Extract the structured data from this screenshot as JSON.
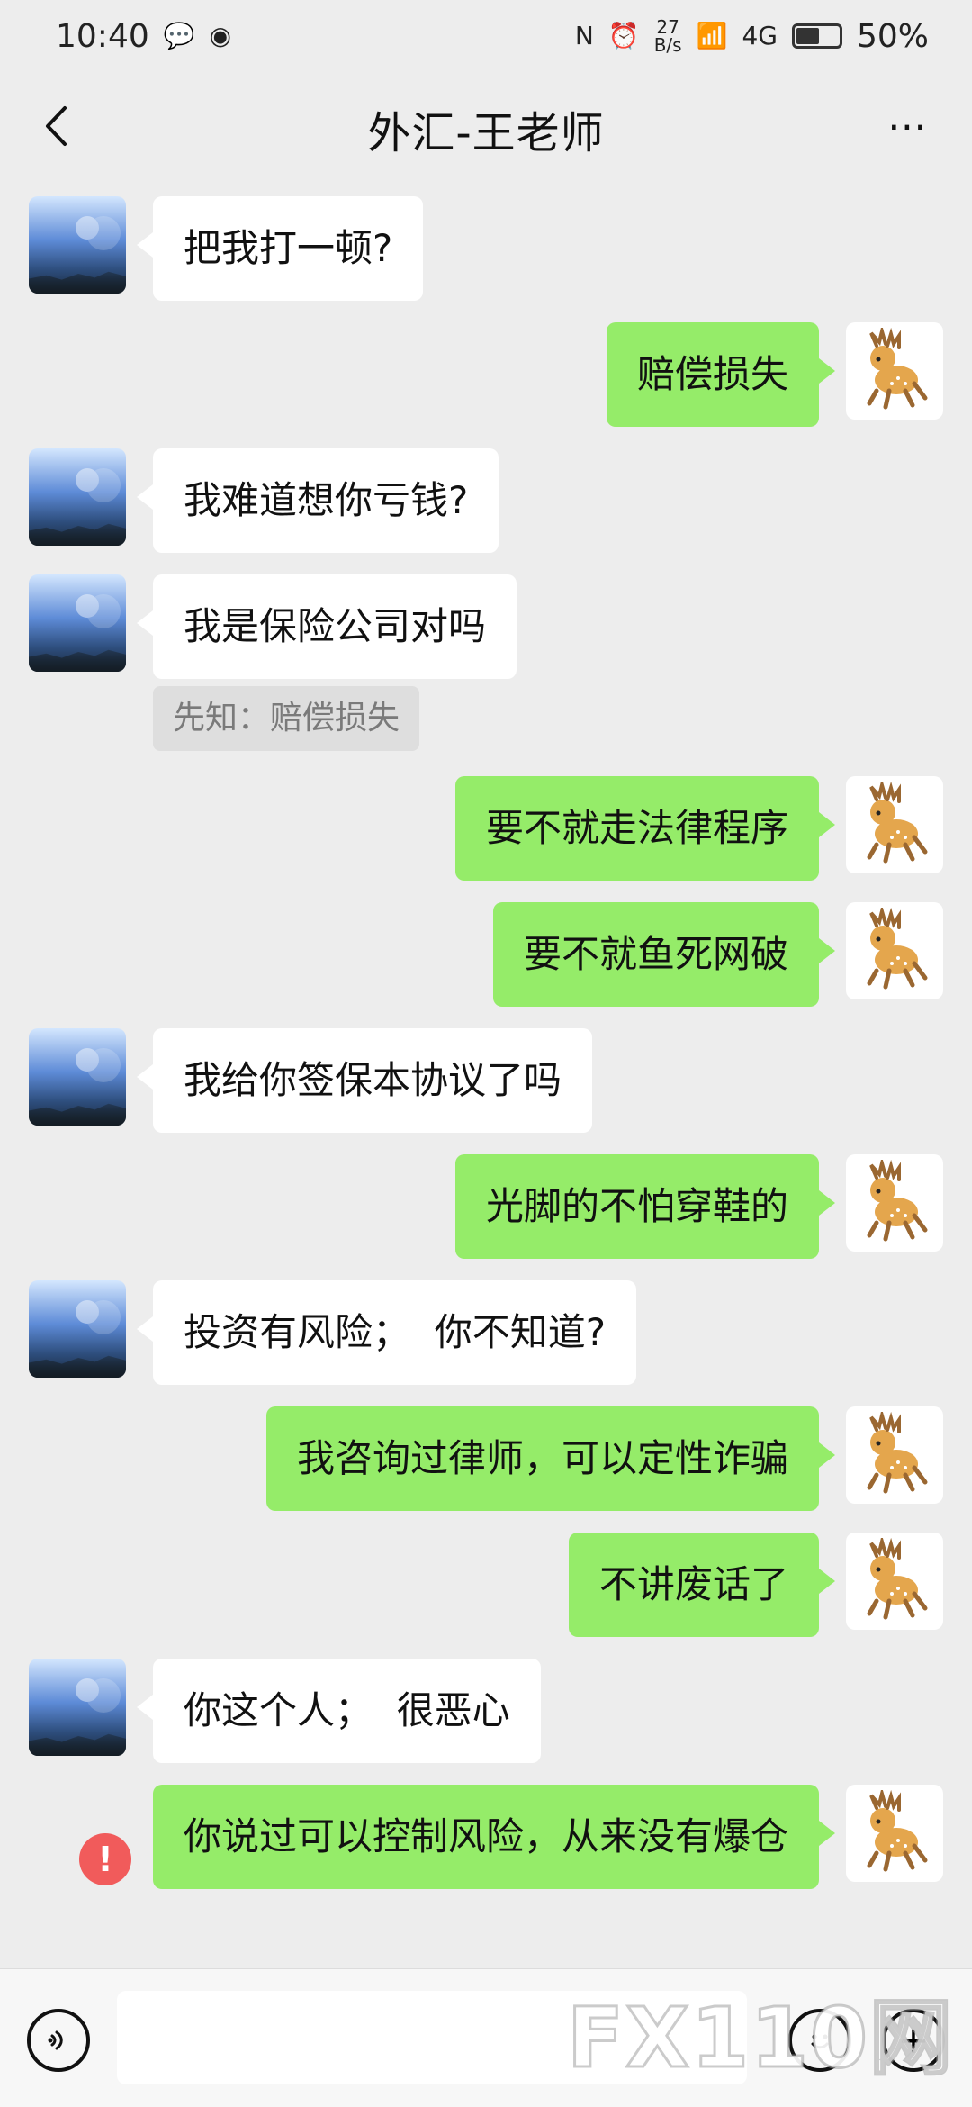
{
  "status_bar": {
    "time": "10:40",
    "speed_top": "27",
    "speed_bottom": "B/s",
    "network": "4G",
    "battery": "50%"
  },
  "header": {
    "title": "外汇-王老师"
  },
  "messages": [
    {
      "side": "left",
      "text": "把我打一顿?"
    },
    {
      "side": "right",
      "text": "赔偿损失"
    },
    {
      "side": "left",
      "text": "我难道想你亏钱?"
    },
    {
      "side": "left",
      "text": "我是保险公司对吗"
    },
    {
      "side": "right",
      "text": "要不就走法律程序"
    },
    {
      "side": "right",
      "text": "要不就鱼死网破"
    },
    {
      "side": "left",
      "text": "我给你签保本协议了吗"
    },
    {
      "side": "right",
      "text": "光脚的不怕穿鞋的"
    },
    {
      "side": "left",
      "text": "投资有风险；  你不知道?"
    },
    {
      "side": "right",
      "text": "我咨询过律师，可以定性诈骗"
    },
    {
      "side": "right",
      "text": "不讲废话了"
    },
    {
      "side": "left",
      "text": "你这个人；  很恶心"
    },
    {
      "side": "right",
      "text": "你说过可以控制风险，从来没有爆仓"
    }
  ],
  "quote": {
    "text": "先知：赔偿损失"
  },
  "watermark": {
    "text": "FX110网"
  },
  "colors": {
    "background": "#ededed",
    "incoming_bubble": "#ffffff",
    "outgoing_bubble": "#95ec69",
    "error": "#f15b5b"
  }
}
